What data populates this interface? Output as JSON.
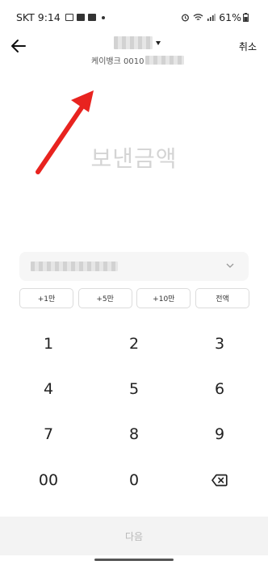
{
  "status_bar": {
    "time": "SKT 9:14",
    "battery": "61%"
  },
  "header": {
    "back_icon": "back-arrow-icon",
    "account_subtitle": "케이뱅크 0010",
    "cancel_label": "취소"
  },
  "amount": {
    "placeholder": "보낸금액"
  },
  "quick_amounts": [
    "+1만",
    "+5만",
    "+10만",
    "전액"
  ],
  "keypad": {
    "keys": [
      "1",
      "2",
      "3",
      "4",
      "5",
      "6",
      "7",
      "8",
      "9",
      "00",
      "0"
    ],
    "backspace_icon": "backspace-icon"
  },
  "footer": {
    "next_label": "다음"
  },
  "colors": {
    "annotation_arrow": "#e8231f",
    "placeholder_text": "#d4d4d4",
    "disabled_button_bg": "#f3f3f3",
    "disabled_button_text": "#b8b8b8"
  }
}
